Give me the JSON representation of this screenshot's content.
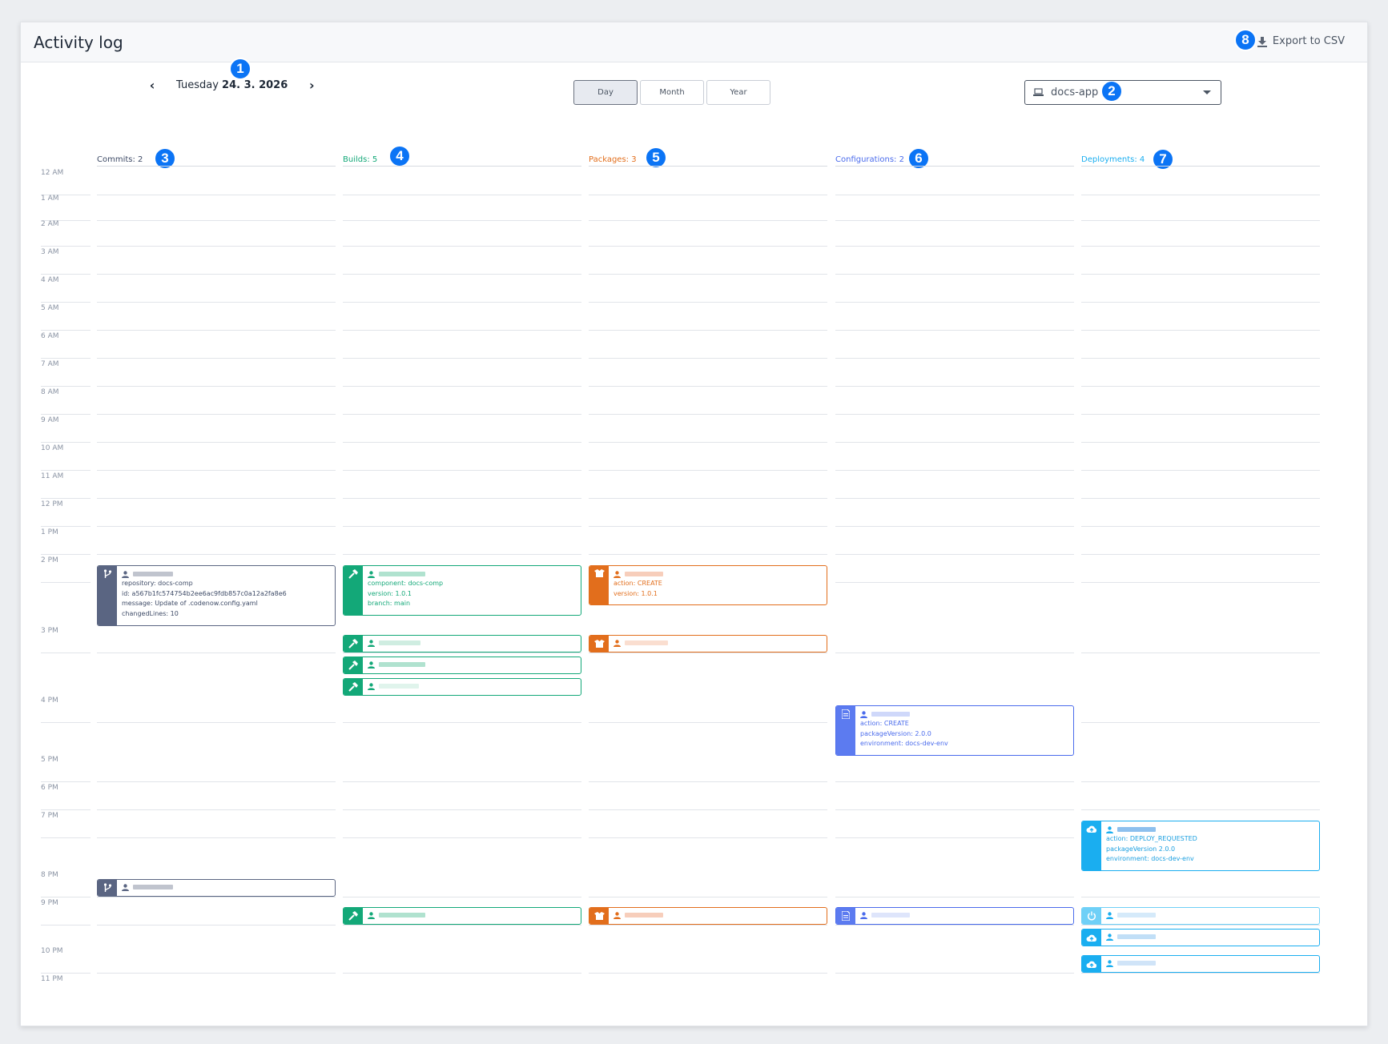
{
  "header": {
    "title": "Activity log",
    "export_label": "Export to CSV"
  },
  "date_nav": {
    "weekday": "Tuesday",
    "date": "24. 3. 2026"
  },
  "view_toggle": {
    "day": "Day",
    "month": "Month",
    "year": "Year",
    "selected": "Day"
  },
  "app_select": {
    "value": "docs-app"
  },
  "badges": [
    "1",
    "2",
    "3",
    "4",
    "5",
    "6",
    "7",
    "8"
  ],
  "columns": [
    {
      "label": "Commits: 2",
      "color": "#3d4a66"
    },
    {
      "label": "Builds: 5",
      "color": "#13a878"
    },
    {
      "label": "Packages: 3",
      "color": "#e26e1c"
    },
    {
      "label": "Configurations: 2",
      "color": "#4a6bec"
    },
    {
      "label": "Deployments: 4",
      "color": "#1aaef0"
    }
  ],
  "hours": [
    "12 AM",
    "1 AM",
    "2 AM",
    "3 AM",
    "4 AM",
    "5 AM",
    "6 AM",
    "7 AM",
    "8 AM",
    "9 AM",
    "10 AM",
    "11 AM",
    "12 PM",
    "1 PM",
    "2 PM",
    "3 PM",
    "4 PM",
    "5 PM",
    "6 PM",
    "7 PM",
    "8 PM",
    "9 PM",
    "10 PM",
    "11 PM"
  ],
  "events": {
    "commit_1": {
      "lines": [
        "repository: docs-comp",
        "id: a567b1fc574754b2ee6ac9fdb857c0a12a2fa8e6",
        "message: Update of .codenow.config.yaml",
        "changedLines: 10"
      ]
    },
    "build_1": {
      "lines": [
        "component: docs-comp",
        "version: 1.0.1",
        "branch: main"
      ]
    },
    "package_1": {
      "lines": [
        "action: CREATE",
        "version: 1.0.1"
      ]
    },
    "config_1": {
      "lines": [
        "action: CREATE",
        "packageVersion: 2.0.0",
        "environment: docs-dev-env"
      ]
    },
    "deploy_1": {
      "lines": [
        "action: DEPLOY_REQUESTED",
        "packageVersion 2.0.0",
        "environment: docs-dev-env"
      ]
    }
  },
  "icons": {
    "commit": "branch-icon",
    "build": "hammer-icon",
    "package": "box-icon",
    "config": "file-icon",
    "deploy": "cloud-upload-icon",
    "power": "power-icon",
    "user": "user-icon",
    "download": "download-icon",
    "laptop": "laptop-icon"
  }
}
